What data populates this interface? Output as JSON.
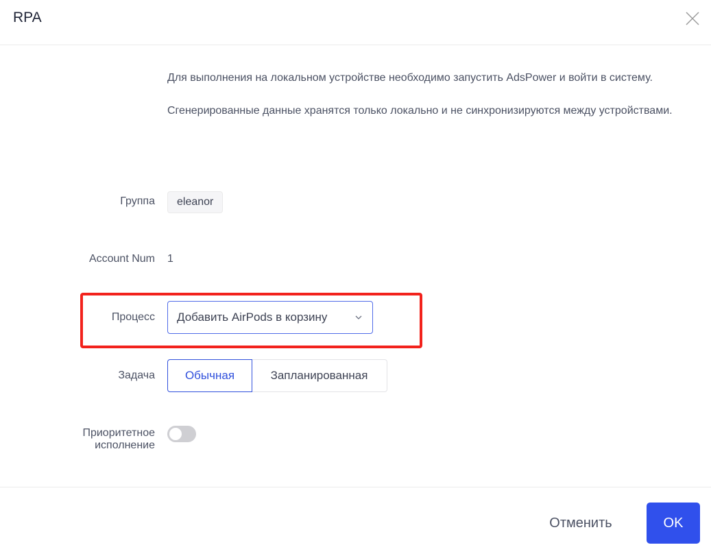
{
  "dialog": {
    "title": "RPA",
    "close_icon": "close-icon"
  },
  "notice": {
    "text": "Для выполнения на локальном устройстве необходимо запустить AdsPower и войти в систему. Сгенерированные данные хранятся только локально и не синхронизируются между устройствами."
  },
  "form": {
    "group": {
      "label": "Группа",
      "value": "eleanor"
    },
    "account_num": {
      "label": "Account Num",
      "value": "1"
    },
    "process": {
      "label": "Процесс",
      "selected": "Добавить AirPods в корзину",
      "arrow_icon": "chevron-down-icon"
    },
    "task": {
      "label": "Задача",
      "options": [
        {
          "label": "Обычная",
          "selected": true
        },
        {
          "label": "Запланированная",
          "selected": false
        }
      ]
    },
    "priority": {
      "label_line1": "Приоритетное",
      "label_line2": "исполнение",
      "enabled": false
    }
  },
  "footer": {
    "cancel_label": "Отменить",
    "ok_label": "OK"
  },
  "colors": {
    "accent": "#3050ec",
    "highlight": "#f2221c",
    "text": "#4b5163"
  }
}
